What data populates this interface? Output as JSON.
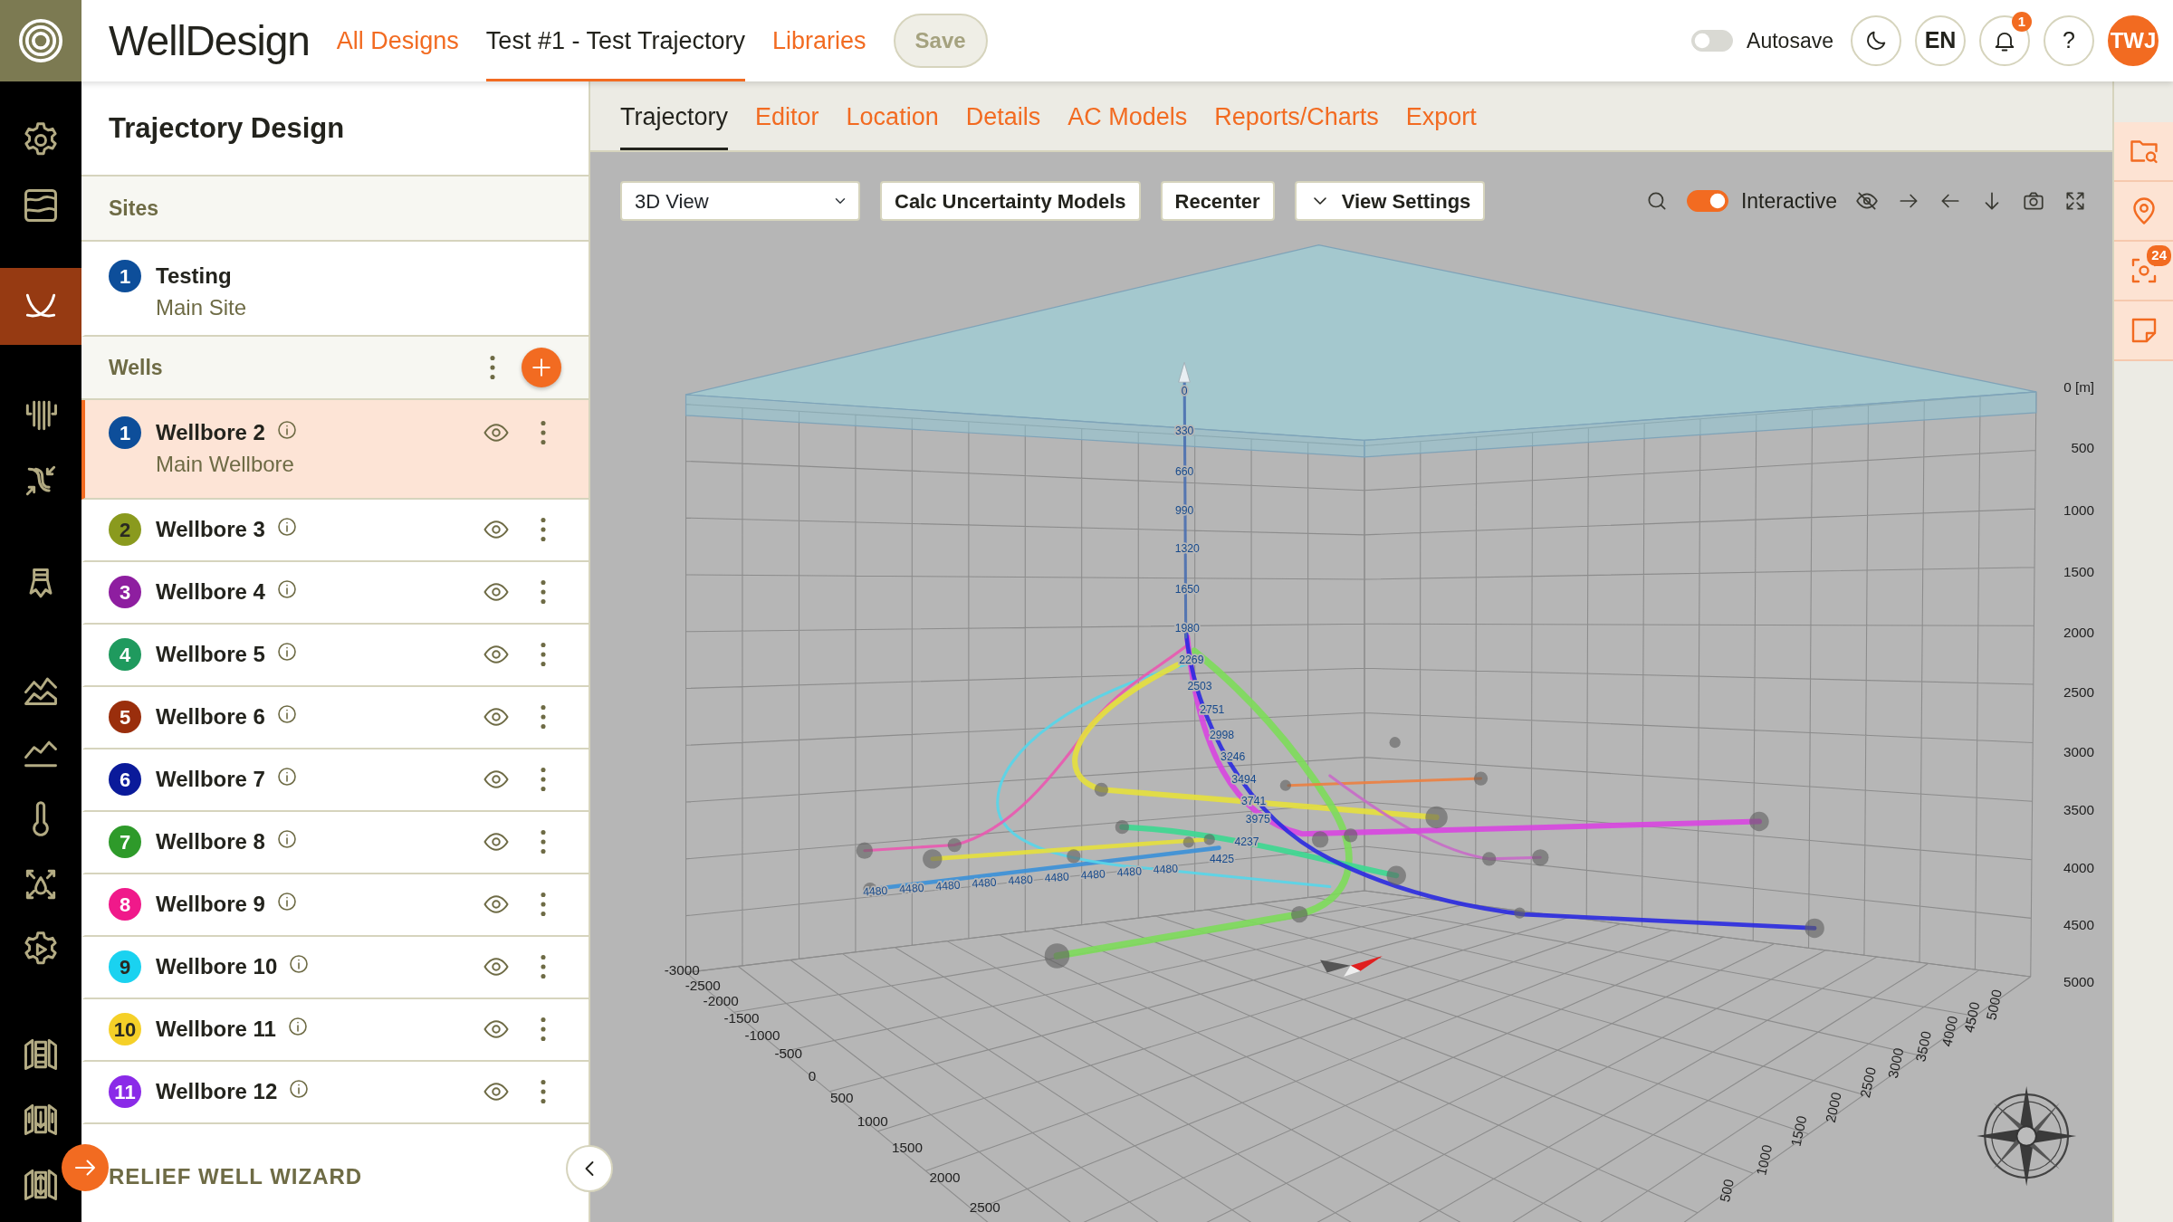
{
  "app": {
    "name": "WellDesign"
  },
  "nav": [
    {
      "label": "All Designs",
      "selected": false
    },
    {
      "label": "Test #1 - Test Trajectory",
      "selected": true
    },
    {
      "label": "Libraries",
      "selected": false
    }
  ],
  "save_button": {
    "label": "Save",
    "disabled": true
  },
  "autosave": {
    "label": "Autosave",
    "on": false
  },
  "header": {
    "language": "EN",
    "notification_count": "1",
    "help": "?",
    "user_initials": "TWJ"
  },
  "rail": [
    {
      "selected": false
    },
    {
      "selected": false
    },
    {
      "selected": true
    },
    {
      "selected": false
    },
    {
      "selected": false
    },
    {
      "selected": false
    },
    {
      "selected": false
    },
    {
      "selected": false
    },
    {
      "selected": false
    },
    {
      "selected": false
    },
    {
      "selected": false
    },
    {
      "selected": false
    },
    {
      "selected": false
    },
    {
      "selected": false
    }
  ],
  "panel": {
    "title": "Trajectory Design",
    "sites_header": "Sites",
    "sites": [
      {
        "number": "1",
        "name": "Testing",
        "subtitle": "Main Site",
        "color": "#0d4e9a"
      }
    ],
    "wells_header": "Wells",
    "wells": [
      {
        "number": "1",
        "name": "Wellbore 2",
        "subtitle": "Main Wellbore",
        "color": "#0d4e9a",
        "selected": true
      },
      {
        "number": "2",
        "name": "Wellbore 3",
        "color": "#8a9a1e",
        "selected": false
      },
      {
        "number": "3",
        "name": "Wellbore 4",
        "color": "#8e1ea0",
        "selected": false
      },
      {
        "number": "4",
        "name": "Wellbore 5",
        "color": "#1f9a5e",
        "selected": false
      },
      {
        "number": "5",
        "name": "Wellbore 6",
        "color": "#9a2e0c",
        "selected": false
      },
      {
        "number": "6",
        "name": "Wellbore 7",
        "color": "#0a1a9a",
        "selected": false
      },
      {
        "number": "7",
        "name": "Wellbore 8",
        "color": "#2e9a2a",
        "selected": false
      },
      {
        "number": "8",
        "name": "Wellbore 9",
        "color": "#f0198a",
        "selected": false
      },
      {
        "number": "9",
        "name": "Wellbore 10",
        "color": "#1ad2f0",
        "selected": false
      },
      {
        "number": "10",
        "name": "Wellbore 11",
        "color": "#f5d028",
        "selected": false
      },
      {
        "number": "11",
        "name": "Wellbore 12",
        "color": "#8a2ae8",
        "selected": false
      }
    ],
    "wizard_link": "RELIEF WELL WIZARD"
  },
  "tabs": [
    {
      "label": "Trajectory",
      "selected": true
    },
    {
      "label": "Editor",
      "selected": false
    },
    {
      "label": "Location",
      "selected": false
    },
    {
      "label": "Details",
      "selected": false
    },
    {
      "label": "AC Models",
      "selected": false
    },
    {
      "label": "Reports/Charts",
      "selected": false
    },
    {
      "label": "Export",
      "selected": false
    }
  ],
  "viewport": {
    "view_select": "3D View",
    "buttons": [
      {
        "label": "Calc Uncertainty Models",
        "kind": "plain"
      },
      {
        "label": "Recenter",
        "kind": "plain"
      },
      {
        "label": "View Settings",
        "kind": "dropdown"
      }
    ],
    "interactive": {
      "label": "Interactive",
      "on": true
    },
    "depth_axis_labels": [
      "0 [m]",
      "500",
      "1000",
      "1500",
      "2000",
      "2500",
      "3000",
      "3500",
      "4000",
      "4500",
      "5000"
    ],
    "x_axis_labels": [
      "-3000",
      "-2500",
      "-2000",
      "-1500",
      "-1000",
      "-500",
      "0",
      "500",
      "1000",
      "1500",
      "2000",
      "2500"
    ],
    "y_axis_labels": [
      "500",
      "1000",
      "1500",
      "2000",
      "2500",
      "3000",
      "3500",
      "4000",
      "4500",
      "5000"
    ],
    "well_depth_labels": [
      "0",
      "330",
      "660",
      "990",
      "1320",
      "1650",
      "1980",
      "2269",
      "2503",
      "2751",
      "2998",
      "3246",
      "3494",
      "3741",
      "3975",
      "4237",
      "4425"
    ],
    "lateral_labels": [
      "4480",
      "4480",
      "4480",
      "4480",
      "4480",
      "4480",
      "4480",
      "4480",
      "4480"
    ]
  },
  "side_tools": {
    "badge": "24"
  }
}
